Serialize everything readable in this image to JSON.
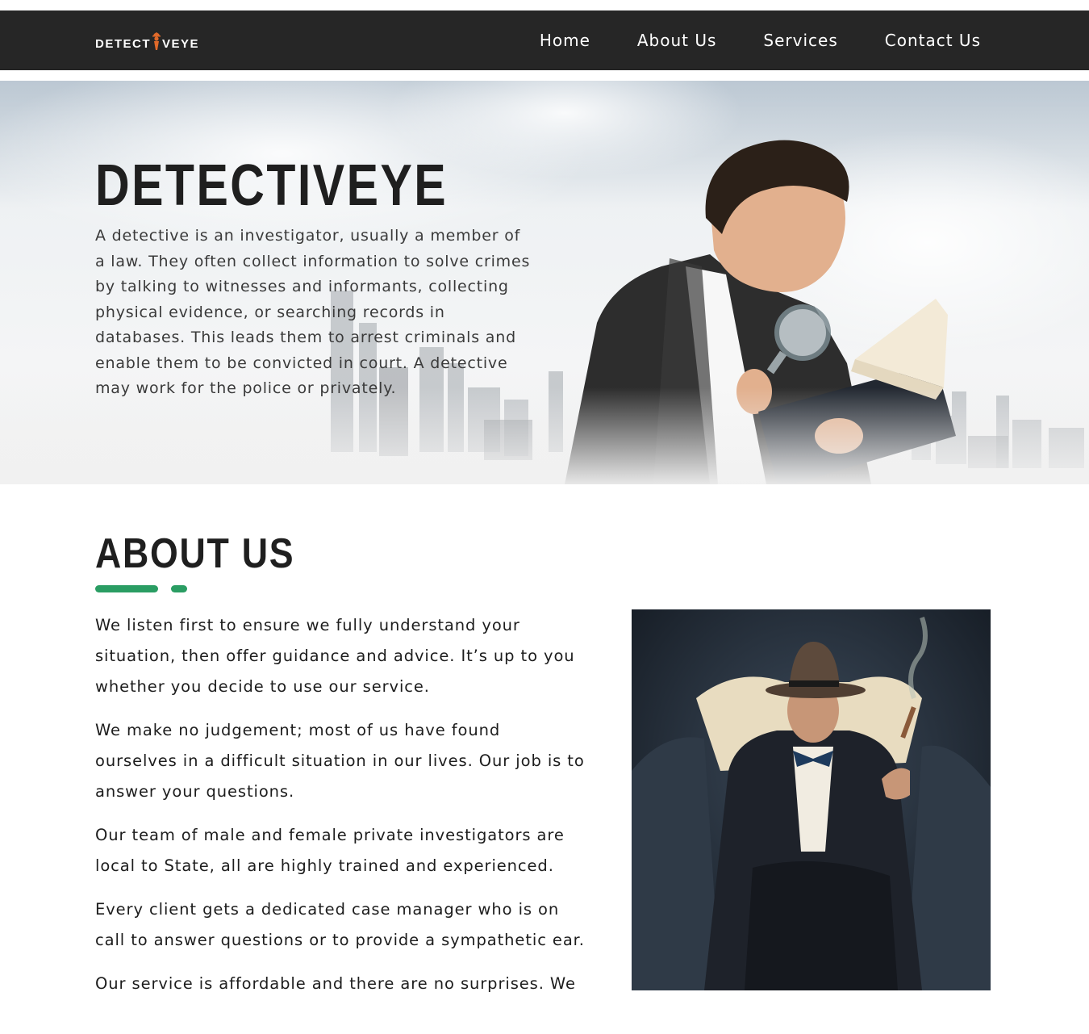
{
  "header": {
    "logo_left": "DETECT",
    "logo_right": "VEYE",
    "nav": [
      "Home",
      "About Us",
      "Services",
      "Contact Us"
    ]
  },
  "hero": {
    "title": "DETECTIVEYE",
    "text": "A detective is an investigator, usually a member of a law. They often collect information to solve crimes by talking to witnesses and informants, collecting physical evidence, or searching records in databases. This leads them to arrest criminals and enable them to be convicted in court. A detective may work for the police or privately."
  },
  "about": {
    "title": "ABOUT US",
    "paragraphs": [
      "We listen first to ensure we fully understand your situation, then offer guidance and advice. It’s up to you whether you decide to use our service.",
      "We make no judgement; most of us have found ourselves in a difficult situation in our lives. Our job is to answer your questions.",
      "Our team of male and female private investigators are local to State, all are highly trained and experienced.",
      "Every client gets a dedicated case manager who is on call to answer questions or to provide a sympathetic ear.",
      "Our service is affordable and there are no surprises. We"
    ]
  },
  "colors": {
    "nav_bg": "#262626",
    "accent_green": "#2a9d63",
    "logo_accent": "#e0692a"
  },
  "icons": {
    "logo_mark": "detective-figure-icon"
  }
}
